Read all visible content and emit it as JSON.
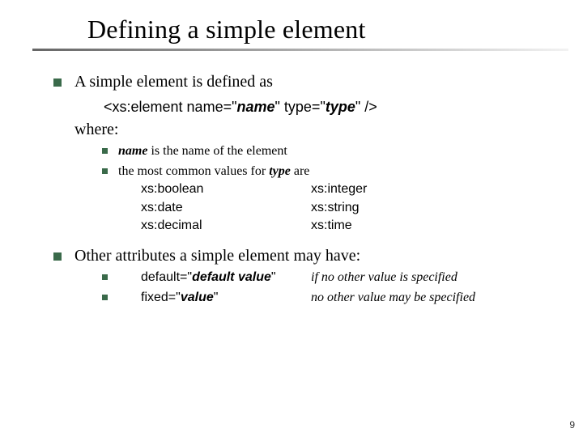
{
  "title": "Defining a simple element",
  "bullet1": {
    "intro": "A simple element is defined as",
    "code_pre": "<xs:element  name=\"",
    "code_name_ital": "name",
    "code_mid": "\"   type=\"",
    "code_type_ital": "type",
    "code_post": "\" />",
    "where": "where:",
    "sub1_pre": "",
    "sub1_name_ital": "name",
    "sub1_post": " is the name of the element",
    "sub2_pre": "the most common values for ",
    "sub2_type_ital": "type",
    "sub2_post": " are",
    "types": {
      "r1c1": "xs:boolean",
      "r1c2": "xs:integer",
      "r2c1": "xs:date",
      "r2c2": "xs:string",
      "r3c1": "xs:decimal",
      "r3c2": "xs:time"
    }
  },
  "bullet2": {
    "intro": "Other attributes a simple element may have:",
    "rows": {
      "r1c1_pre": "default=\"",
      "r1c1_ital": "default value",
      "r1c1_post": "\"",
      "r1c2": "if no other value is specified",
      "r2c1_pre": "fixed=\"",
      "r2c1_ital": "value",
      "r2c1_post": "\"",
      "r2c2": "no other value may be specified"
    }
  },
  "page_number": "9"
}
